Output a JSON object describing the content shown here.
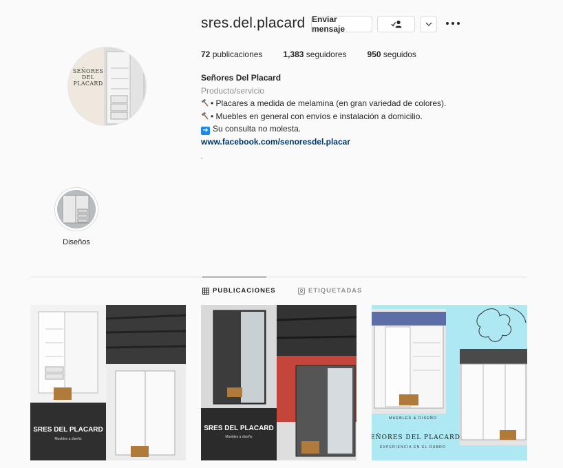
{
  "profile": {
    "username": "sres.del.placard",
    "message_button": "Enviar mensaje",
    "stats": {
      "posts_count": "72",
      "posts_label": "publicaciones",
      "followers_count": "1,383",
      "followers_label": "seguidores",
      "following_count": "950",
      "following_label": "seguidos"
    },
    "full_name": "Señores Del Placard",
    "category": "Producto/servicio",
    "bio_line1": "• Placares a medida de melamina (en gran variedad de colores).",
    "bio_line2": "• Muebles en general con envíos e instalación a domicilio.",
    "bio_line3": "Su consulta no molesta.",
    "website": "www.facebook.com/senoresdel.placar",
    "avatar_text": "SEÑORES DEL PLACARD"
  },
  "highlights": [
    {
      "label": "Diseños"
    }
  ],
  "tabs": {
    "posts": "PUBLICACIONES",
    "tagged": "ETIQUETADAS"
  },
  "posts": [
    {
      "caption_line1": "SRES DEL PLACARD",
      "caption_line2": "Muebles a diseño"
    },
    {
      "caption_line1": "SRES DEL PLACARD",
      "caption_line2": "Muebles a diseño"
    },
    {
      "caption_line1": "MUEBLES & DISEÑO",
      "caption_line2": "SEÑORES DEL PLACARD",
      "caption_line3": "EXPERIENCIA EN EL RUBRO"
    }
  ],
  "colors": {
    "background": "#fafafa",
    "link": "#00376b",
    "muted": "#8e8e8e",
    "accent_cyan": "#aee8f2"
  }
}
